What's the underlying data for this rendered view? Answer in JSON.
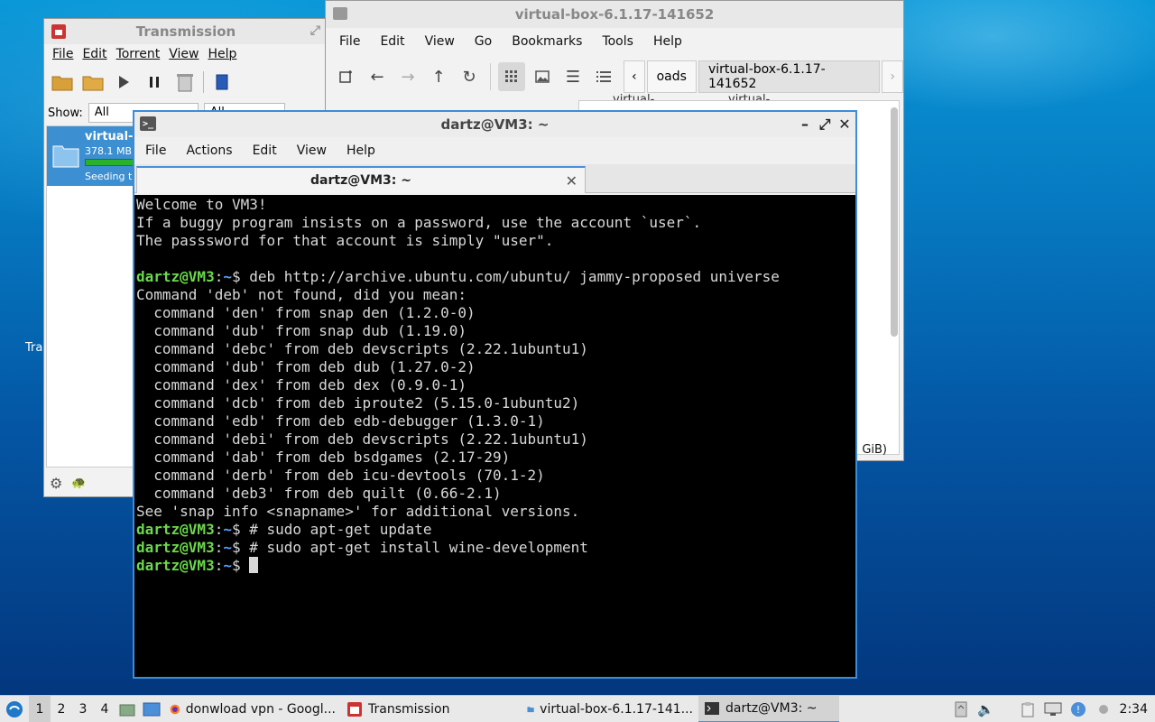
{
  "desktop": {
    "fragment_label": "Tra"
  },
  "transmission": {
    "title": "Transmission",
    "menu": [
      "File",
      "Edit",
      "Torrent",
      "View",
      "Help"
    ],
    "show_label": "Show:",
    "filter_value": "All",
    "filter2_value": "All",
    "torrent": {
      "name": "virtual-b",
      "size": "378.1 MB,",
      "status": "Seeding t",
      "progress": 1.0
    }
  },
  "file_manager": {
    "title": "virtual-box-6.1.17-141652",
    "menu": [
      "File",
      "Edit",
      "View",
      "Go",
      "Bookmarks",
      "Tools",
      "Help"
    ],
    "breadcrumb_prev": "oads",
    "breadcrumb_current": "virtual-box-6.1.17-141652",
    "item1": "virtual-",
    "item2": "virtual-",
    "size_fragment": "GiB)"
  },
  "terminal": {
    "title": "dartz@VM3: ~",
    "menu": [
      "File",
      "Actions",
      "Edit",
      "View",
      "Help"
    ],
    "tab_label": "dartz@VM3: ~",
    "lines": [
      {
        "text": "Welcome to VM3!"
      },
      {
        "text": "If a buggy program insists on a password, use the account `user`."
      },
      {
        "text": "The passsword for that account is simply \"user\"."
      },
      {
        "text": ""
      },
      {
        "user": "dartz@VM3",
        "path": "~",
        "text": "$ deb http://archive.ubuntu.com/ubuntu/ jammy-proposed universe"
      },
      {
        "text": "Command 'deb' not found, did you mean:"
      },
      {
        "text": "  command 'den' from snap den (1.2.0-0)"
      },
      {
        "text": "  command 'dub' from snap dub (1.19.0)"
      },
      {
        "text": "  command 'debc' from deb devscripts (2.22.1ubuntu1)"
      },
      {
        "text": "  command 'dub' from deb dub (1.27.0-2)"
      },
      {
        "text": "  command 'dex' from deb dex (0.9.0-1)"
      },
      {
        "text": "  command 'dcb' from deb iproute2 (5.15.0-1ubuntu2)"
      },
      {
        "text": "  command 'edb' from deb edb-debugger (1.3.0-1)"
      },
      {
        "text": "  command 'debi' from deb devscripts (2.22.1ubuntu1)"
      },
      {
        "text": "  command 'dab' from deb bsdgames (2.17-29)"
      },
      {
        "text": "  command 'derb' from deb icu-devtools (70.1-2)"
      },
      {
        "text": "  command 'deb3' from deb quilt (0.66-2.1)"
      },
      {
        "text": "See 'snap info <snapname>' for additional versions."
      },
      {
        "user": "dartz@VM3",
        "path": "~",
        "text": "$ # sudo apt-get update"
      },
      {
        "user": "dartz@VM3",
        "path": "~",
        "text": "$ # sudo apt-get install wine-development"
      },
      {
        "user": "dartz@VM3",
        "path": "~",
        "text": "$ ",
        "cursor": true
      }
    ]
  },
  "taskbar": {
    "workspaces": [
      "1",
      "2",
      "3",
      "4"
    ],
    "items": [
      {
        "label": "donwload vpn - Googl...",
        "icon": "firefox-icon"
      },
      {
        "label": "Transmission",
        "icon": "transmission-icon"
      },
      {
        "label": "virtual-box-6.1.17-141...",
        "icon": "folder-icon"
      },
      {
        "label": "dartz@VM3: ~",
        "icon": "terminal-icon"
      }
    ],
    "clock": "2:34"
  },
  "colors": {
    "accent": "#3d8cd8",
    "prompt_user": "#6ad94a",
    "prompt_path": "#5aa0ff",
    "selection": "#3c8fd0"
  }
}
